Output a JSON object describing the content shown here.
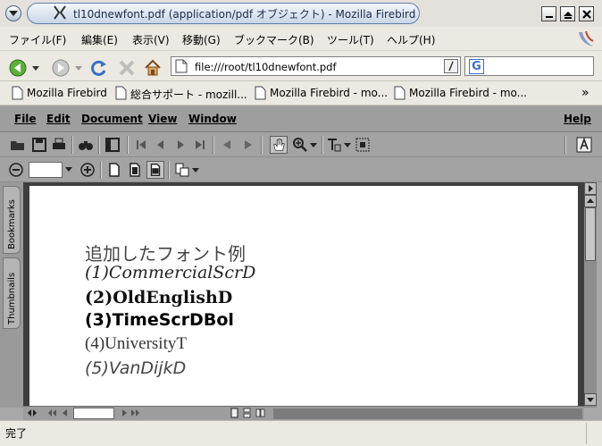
{
  "window": {
    "title": "tl10dnewfont.pdf (application/pdf オブジェクト) - Mozilla Firebird"
  },
  "menubar": {
    "items": [
      {
        "label": "ファイル(F)"
      },
      {
        "label": "編集(E)"
      },
      {
        "label": "表示(V)"
      },
      {
        "label": "移動(G)"
      },
      {
        "label": "ブックマーク(B)"
      },
      {
        "label": "ツール(T)"
      },
      {
        "label": "ヘルプ(H)"
      }
    ]
  },
  "navbar": {
    "url": "file:///root/tl10dnewfont.pdf",
    "search_value": "",
    "search_engine_icon": "G"
  },
  "bookmarks": {
    "items": [
      {
        "label": "Mozilla Firebird"
      },
      {
        "label": "総合サポート - mozill..."
      },
      {
        "label": "Mozilla Firebird - mo..."
      },
      {
        "label": "Mozilla Firebird - mo..."
      }
    ],
    "more": "»"
  },
  "reader": {
    "menu": {
      "file": "File",
      "edit": "Edit",
      "document": "Document",
      "view": "View",
      "window": "Window",
      "help": "Help"
    },
    "zoom_value": "",
    "side_tabs": {
      "bookmarks": "Bookmarks",
      "thumbnails": "Thumbnails"
    },
    "page_field": "",
    "document_lines": [
      "追加したフォント例",
      "(1)CommercialScrD",
      "(2)OldEnglishD",
      "(3)TimeScrDBol",
      "(4)UniversityT",
      "(5)VanDijkD"
    ]
  },
  "status": {
    "text": "完了"
  }
}
